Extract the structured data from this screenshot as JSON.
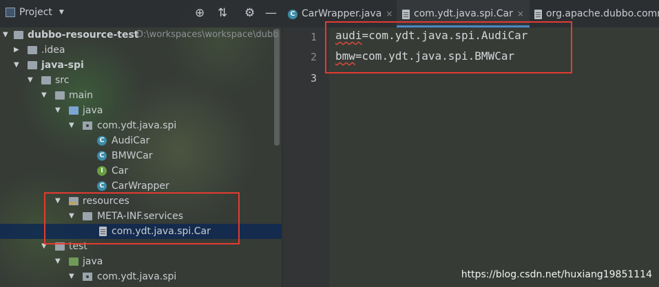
{
  "project_panel": {
    "title": "Project",
    "header_icons": [
      "crosshair-icon",
      "collapse-icon",
      "gear-icon",
      "minimize-icon"
    ],
    "tree": [
      {
        "label": "dubbo-resource-test",
        "path": "D:\\workspaces\\workspace\\dubb",
        "icon": "module-folder-icon",
        "expanded": true
      },
      {
        "label": ".idea",
        "icon": "folder-icon",
        "expanded": false
      },
      {
        "label": "java-spi",
        "icon": "module-folder-icon",
        "expanded": true
      },
      {
        "label": "src",
        "icon": "folder-icon",
        "expanded": true
      },
      {
        "label": "main",
        "icon": "folder-icon",
        "expanded": true
      },
      {
        "label": "java",
        "icon": "source-folder-icon",
        "expanded": true
      },
      {
        "label": "com.ydt.java.spi",
        "icon": "package-icon",
        "expanded": true
      },
      {
        "label": "AudiCar",
        "icon": "class-icon",
        "badge": "C"
      },
      {
        "label": "BMWCar",
        "icon": "class-icon",
        "badge": "C"
      },
      {
        "label": "Car",
        "icon": "interface-icon",
        "badge": "I"
      },
      {
        "label": "CarWrapper",
        "icon": "class-icon",
        "badge": "C"
      },
      {
        "label": "resources",
        "icon": "resources-folder-icon",
        "expanded": true
      },
      {
        "label": "META-INF.services",
        "icon": "folder-icon",
        "expanded": true
      },
      {
        "label": "com.ydt.java.spi.Car",
        "icon": "file-icon",
        "selected": true
      },
      {
        "label": "test",
        "icon": "folder-icon",
        "expanded": true
      },
      {
        "label": "java",
        "icon": "test-folder-icon",
        "expanded": true
      },
      {
        "label": "com.ydt.java.spi",
        "icon": "package-icon",
        "expanded": true
      }
    ]
  },
  "editor": {
    "tabs": [
      {
        "label": "CarWrapper.java",
        "icon": "class-icon",
        "badge": "C",
        "active": false,
        "close": "×"
      },
      {
        "label": "com.ydt.java.spi.Car",
        "icon": "file-icon",
        "active": true,
        "close": "×"
      },
      {
        "label": "org.apache.dubbo.comm",
        "icon": "file-icon",
        "active": false
      }
    ],
    "line_numbers": [
      "1",
      "2",
      "3"
    ],
    "lines": [
      {
        "key": "audi",
        "rest": "=com.ydt.java.spi.AudiCar"
      },
      {
        "key": "bmw",
        "rest": "=com.ydt.java.spi.BMWCar"
      }
    ]
  },
  "watermark": "https://blog.csdn.net/huxiang19851114",
  "colors": {
    "highlight_box": "#e53b30",
    "selection": "#0e2952",
    "tab_active_underline": "#4a88c7"
  }
}
